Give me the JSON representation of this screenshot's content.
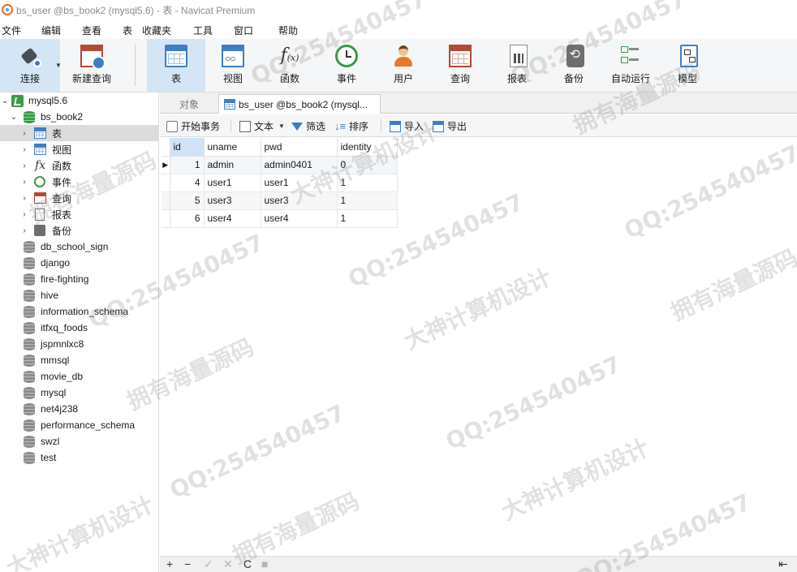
{
  "window": {
    "title": "bs_user @bs_book2 (mysql5.6) - 表 - Navicat Premium"
  },
  "menu": {
    "items": [
      "文件",
      "编辑",
      "查看",
      "表",
      "收藏夹",
      "工具",
      "窗口",
      "帮助"
    ]
  },
  "toolbar": {
    "connect_label": "连接",
    "new_query_label": "新建查询",
    "table_label": "表",
    "view_label": "视图",
    "function_label": "函数",
    "event_label": "事件",
    "user_label": "用户",
    "query_label": "查询",
    "report_label": "报表",
    "backup_label": "备份",
    "autorun_label": "自动运行",
    "model_label": "模型",
    "active": "表"
  },
  "nav": {
    "connection": "mysql5.6",
    "open_database": "bs_book2",
    "object_groups": [
      "表",
      "视图",
      "函数",
      "事件",
      "查询",
      "报表",
      "备份"
    ],
    "selected_group": "表",
    "databases": [
      "db_school_sign",
      "django",
      "fire-fighting",
      "hive",
      "information_schema",
      "itfxq_foods",
      "jspmnlxc8",
      "mmsql",
      "movie_db",
      "mysql",
      "net4j238",
      "performance_schema",
      "swzl",
      "test"
    ]
  },
  "tabs": {
    "objects_label": "对象",
    "active_label": "bs_user @bs_book2 (mysql..."
  },
  "object_toolbar": {
    "begin_transaction": "开始事务",
    "text": "文本",
    "filter": "筛选",
    "sort": "排序",
    "import": "导入",
    "export": "导出"
  },
  "grid": {
    "columns": [
      "id",
      "uname",
      "pwd",
      "identity"
    ],
    "rows": [
      [
        "1",
        "admin",
        "admin0401",
        "0"
      ],
      [
        "4",
        "user1",
        "user1",
        "1"
      ],
      [
        "5",
        "user3",
        "user3",
        "1"
      ],
      [
        "6",
        "user4",
        "user4",
        "1"
      ]
    ],
    "current_row_marker": "▶"
  },
  "bottombar": {
    "add": "+",
    "delete": "−",
    "apply": "✓",
    "cancel": "✕",
    "refresh": "C",
    "stop": "■",
    "first": "⇤"
  },
  "watermarks": {
    "qq": "QQ:254540457",
    "slogan1": "拥有海量源码",
    "slogan2": "大神计算机设计"
  }
}
